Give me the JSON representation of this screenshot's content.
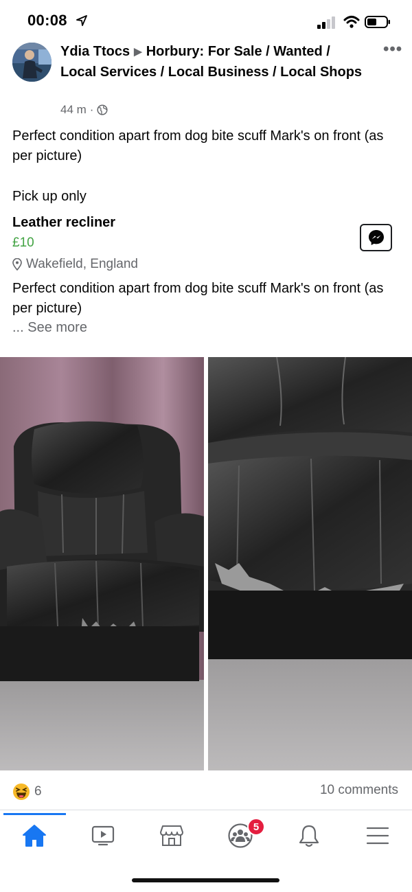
{
  "status_bar": {
    "time": "00:08",
    "icons": [
      "location-arrow-icon",
      "signal-icon",
      "wifi-icon",
      "battery-icon"
    ]
  },
  "post": {
    "author": "Ydia Ttocs",
    "group": "Horbury: For Sale /  Wanted / Local Services / Local Business / Local Shops",
    "time_ago": "44 m",
    "separator": "·",
    "privacy_icon": "globe-icon",
    "body_line": "Perfect condition apart from dog bite scuff Mark's on front (as per picture)",
    "pickup": "Pick up only"
  },
  "listing": {
    "title": "Leather recliner",
    "price": "£10",
    "location": "Wakefield, England",
    "description": "Perfect condition apart from dog bite scuff Mark's on front (as per picture)",
    "see_more": "... See more"
  },
  "engagement": {
    "reaction_icon": "haha-icon",
    "reaction_count": "6",
    "comments": "10 comments"
  },
  "nav": {
    "items": [
      "home-icon",
      "watch-icon",
      "marketplace-icon",
      "groups-icon",
      "notifications-icon",
      "menu-icon"
    ],
    "groups_badge": "5",
    "active_color": "#1877f2"
  },
  "colors": {
    "price_green": "#42a343",
    "secondary_text": "#65676b",
    "badge_red": "#e41e3f"
  }
}
